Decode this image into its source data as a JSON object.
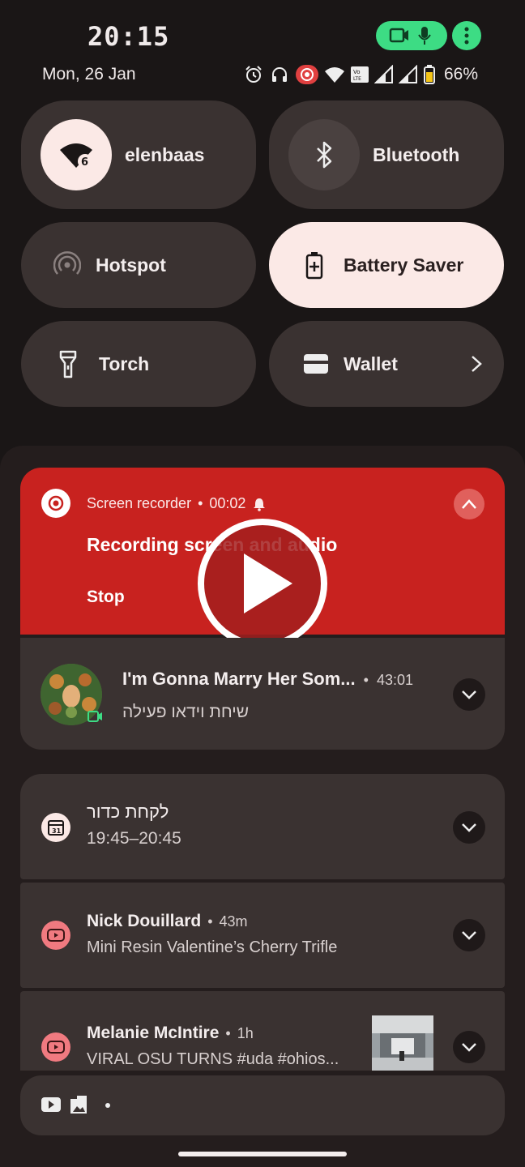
{
  "status": {
    "time": "20:15",
    "date": "Mon, 26 Jan",
    "battery": "66%"
  },
  "tiles": {
    "wifi": "elenbaas",
    "wifi_badge": "6",
    "bluetooth": "Bluetooth",
    "hotspot": "Hotspot",
    "battery_saver": "Battery Saver",
    "torch": "Torch",
    "wallet": "Wallet"
  },
  "recorder": {
    "app": "Screen recorder",
    "elapsed": "00:02",
    "title": "Recording screen and audio",
    "stop": "Stop"
  },
  "notifications": [
    {
      "title": "I'm Gonna Marry Her Som...",
      "time": "43:01",
      "text": "שיחת וידאו פעילה"
    },
    {
      "title": "לקחת כדור",
      "text": "19:45–20:45",
      "icon_text": "31"
    },
    {
      "title": "Nick Douillard",
      "time": "43m",
      "text": "Mini Resin Valentine’s Cherry Trifle"
    },
    {
      "title": "Melanie McIntire",
      "time": "1h",
      "text": "VIRAL OSU TURNS #uda #ohios..."
    }
  ],
  "colors": {
    "recorder": "#c8221f",
    "youtube": "#f07a80",
    "privacy": "#3ddc84"
  }
}
